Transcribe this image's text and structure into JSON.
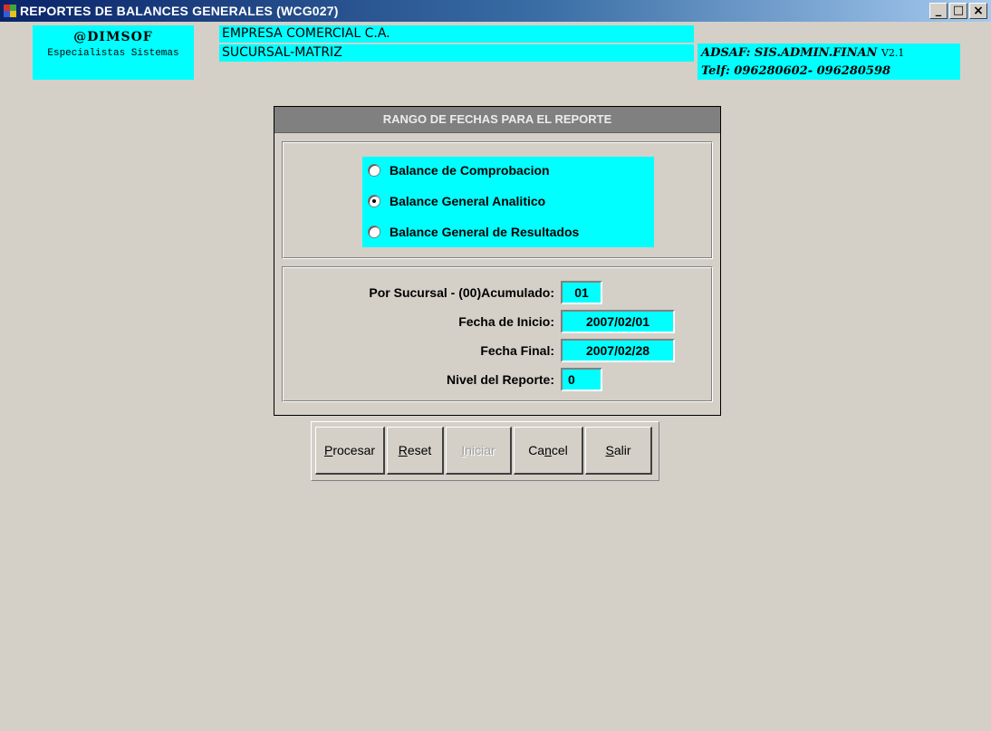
{
  "window": {
    "title": "REPORTES DE BALANCES GENERALES (WCG027)",
    "minimize_label": "_",
    "maximize_label": "□",
    "close_label": "×"
  },
  "header": {
    "logo_name": "@DIMSOF",
    "logo_subtitle": "Especialistas Sistemas",
    "company": "EMPRESA COMERCIAL C.A.",
    "branch": "SUCURSAL-MATRIZ",
    "system_name": "ADSAF: SIS.ADMIN.FINAN",
    "system_version": "V2.1",
    "phones": "Telf: 096280602- 096280598"
  },
  "dialog": {
    "title": "RANGO DE FECHAS PARA EL REPORTE",
    "report_types": [
      {
        "label": "Balance de Comprobacion",
        "checked": false
      },
      {
        "label": "Balance General Analitico",
        "checked": true
      },
      {
        "label": "Balance General de Resultados",
        "checked": false
      }
    ],
    "fields": [
      {
        "label": "Por Sucursal - (00)Acumulado:",
        "value": "01"
      },
      {
        "label": "Fecha de Inicio:",
        "value": "2007/02/01"
      },
      {
        "label": "Fecha Final:",
        "value": "2007/02/28"
      },
      {
        "label": "Nivel del Reporte:",
        "value": "0"
      }
    ]
  },
  "toolbar": {
    "procesar": {
      "hotkey": "P",
      "rest": "rocesar"
    },
    "reset": {
      "hotkey": "R",
      "rest": "eset"
    },
    "iniciar": {
      "hotkey": "I",
      "rest": "niciar"
    },
    "cancel": {
      "before": "Ca",
      "hotkey": "n",
      "rest": "cel"
    },
    "salir": {
      "hotkey": "S",
      "rest": "alir"
    }
  },
  "colors": {
    "accent": "#00ffff",
    "title_bar": "#0a246a",
    "background": "#d4d0c8",
    "dialog_header": "#808080"
  }
}
